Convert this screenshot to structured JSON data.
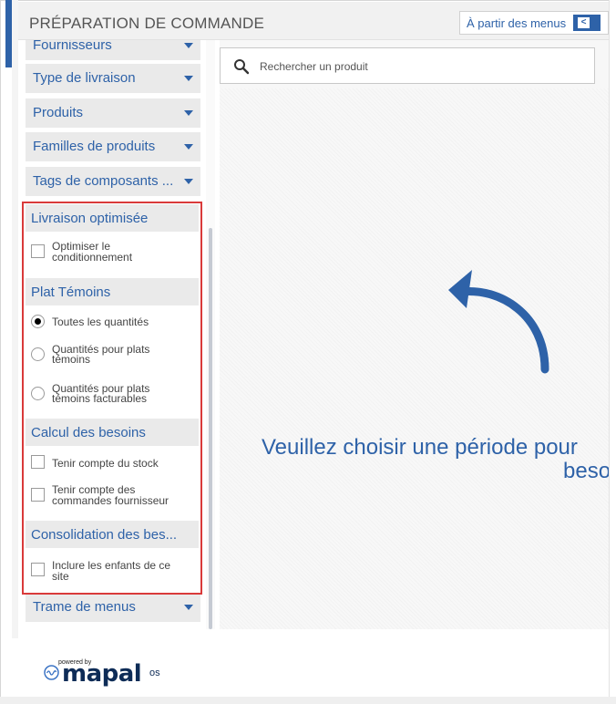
{
  "header": {
    "title": "PRÉPARATION DE COMMANDE",
    "from_menus_label": "À partir des menus",
    "collapse_label": "<"
  },
  "sidebar": {
    "filters_top": [
      {
        "label": "Fournisseurs"
      },
      {
        "label": "Type de livraison"
      },
      {
        "label": "Produits"
      },
      {
        "label": "Familles de produits"
      },
      {
        "label": "Tags de composants ..."
      }
    ],
    "optimized_delivery": {
      "title": "Livraison optimisée",
      "options": [
        {
          "label_line1": "Optimiser le",
          "label_line2": "conditionnement",
          "checked": false
        }
      ]
    },
    "witness_dish": {
      "title": "Plat Témoins",
      "options": [
        {
          "label_line1": "Toutes les quantités",
          "label_line2": "",
          "selected": true
        },
        {
          "label_line1": "Quantités pour plats",
          "label_line2": "témoins",
          "selected": false
        },
        {
          "label_line1": "Quantités pour plats",
          "label_line2": "témoins facturables",
          "selected": false
        }
      ]
    },
    "needs_calc": {
      "title": "Calcul des besoins",
      "options": [
        {
          "label_line1": "Tenir compte du stock",
          "label_line2": "",
          "checked": false
        },
        {
          "label_line1": "Tenir compte des",
          "label_line2": "commandes fournisseur",
          "checked": false
        }
      ]
    },
    "consolidation": {
      "title": "Consolidation des bes...",
      "options": [
        {
          "label_line1": "Inclure les enfants de ce",
          "label_line2": "site",
          "checked": false
        }
      ]
    },
    "filters_bottom": [
      {
        "label": "Trame de menus"
      }
    ]
  },
  "main": {
    "search_placeholder": "Rechercher un produit",
    "message_line1": "Veuillez choisir une période pour",
    "message_line2": "beso"
  },
  "footer": {
    "powered_by": "powered by",
    "brand": "mapal",
    "brand_suffix": "os"
  },
  "colors": {
    "accent": "#2e62a8",
    "highlight_border": "#d93a3a",
    "brand_dark": "#0e2c57"
  }
}
